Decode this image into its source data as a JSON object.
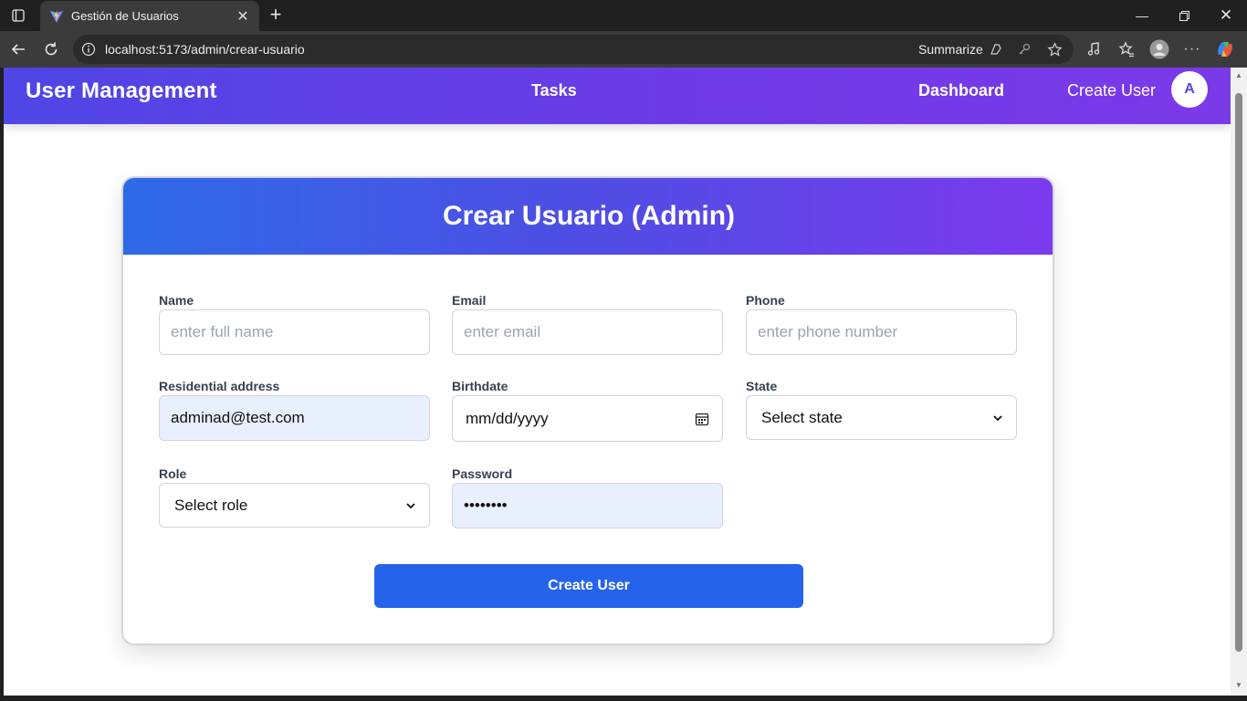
{
  "browser": {
    "tab_title": "Gestión de Usuarios",
    "url": "localhost:5173/admin/crear-usuario",
    "summarize_label": "Summarize"
  },
  "navbar": {
    "brand": "User Management",
    "links": [
      "Tasks",
      "Dashboard",
      "Create User"
    ],
    "avatar_initial": "A",
    "gradient_colors": [
      "#4f46e5",
      "#7b3ae8"
    ]
  },
  "form": {
    "title": "Crear Usuario (Admin)",
    "fields": {
      "name": {
        "label": "Name",
        "placeholder": "enter full name",
        "value": ""
      },
      "email": {
        "label": "Email",
        "placeholder": "enter email",
        "value": ""
      },
      "phone": {
        "label": "Phone",
        "placeholder": "enter phone number",
        "value": ""
      },
      "address": {
        "label": "Residential address",
        "value": "adminad@test.com"
      },
      "birthdate": {
        "label": "Birthdate",
        "value": "mm/dd/yyyy"
      },
      "state": {
        "label": "State",
        "value": "Select state"
      },
      "role": {
        "label": "Role",
        "value": "Select role"
      },
      "password": {
        "label": "Password",
        "value": "••••••••"
      }
    },
    "submit_label": "Create User",
    "submit_color": "#2563eb"
  }
}
